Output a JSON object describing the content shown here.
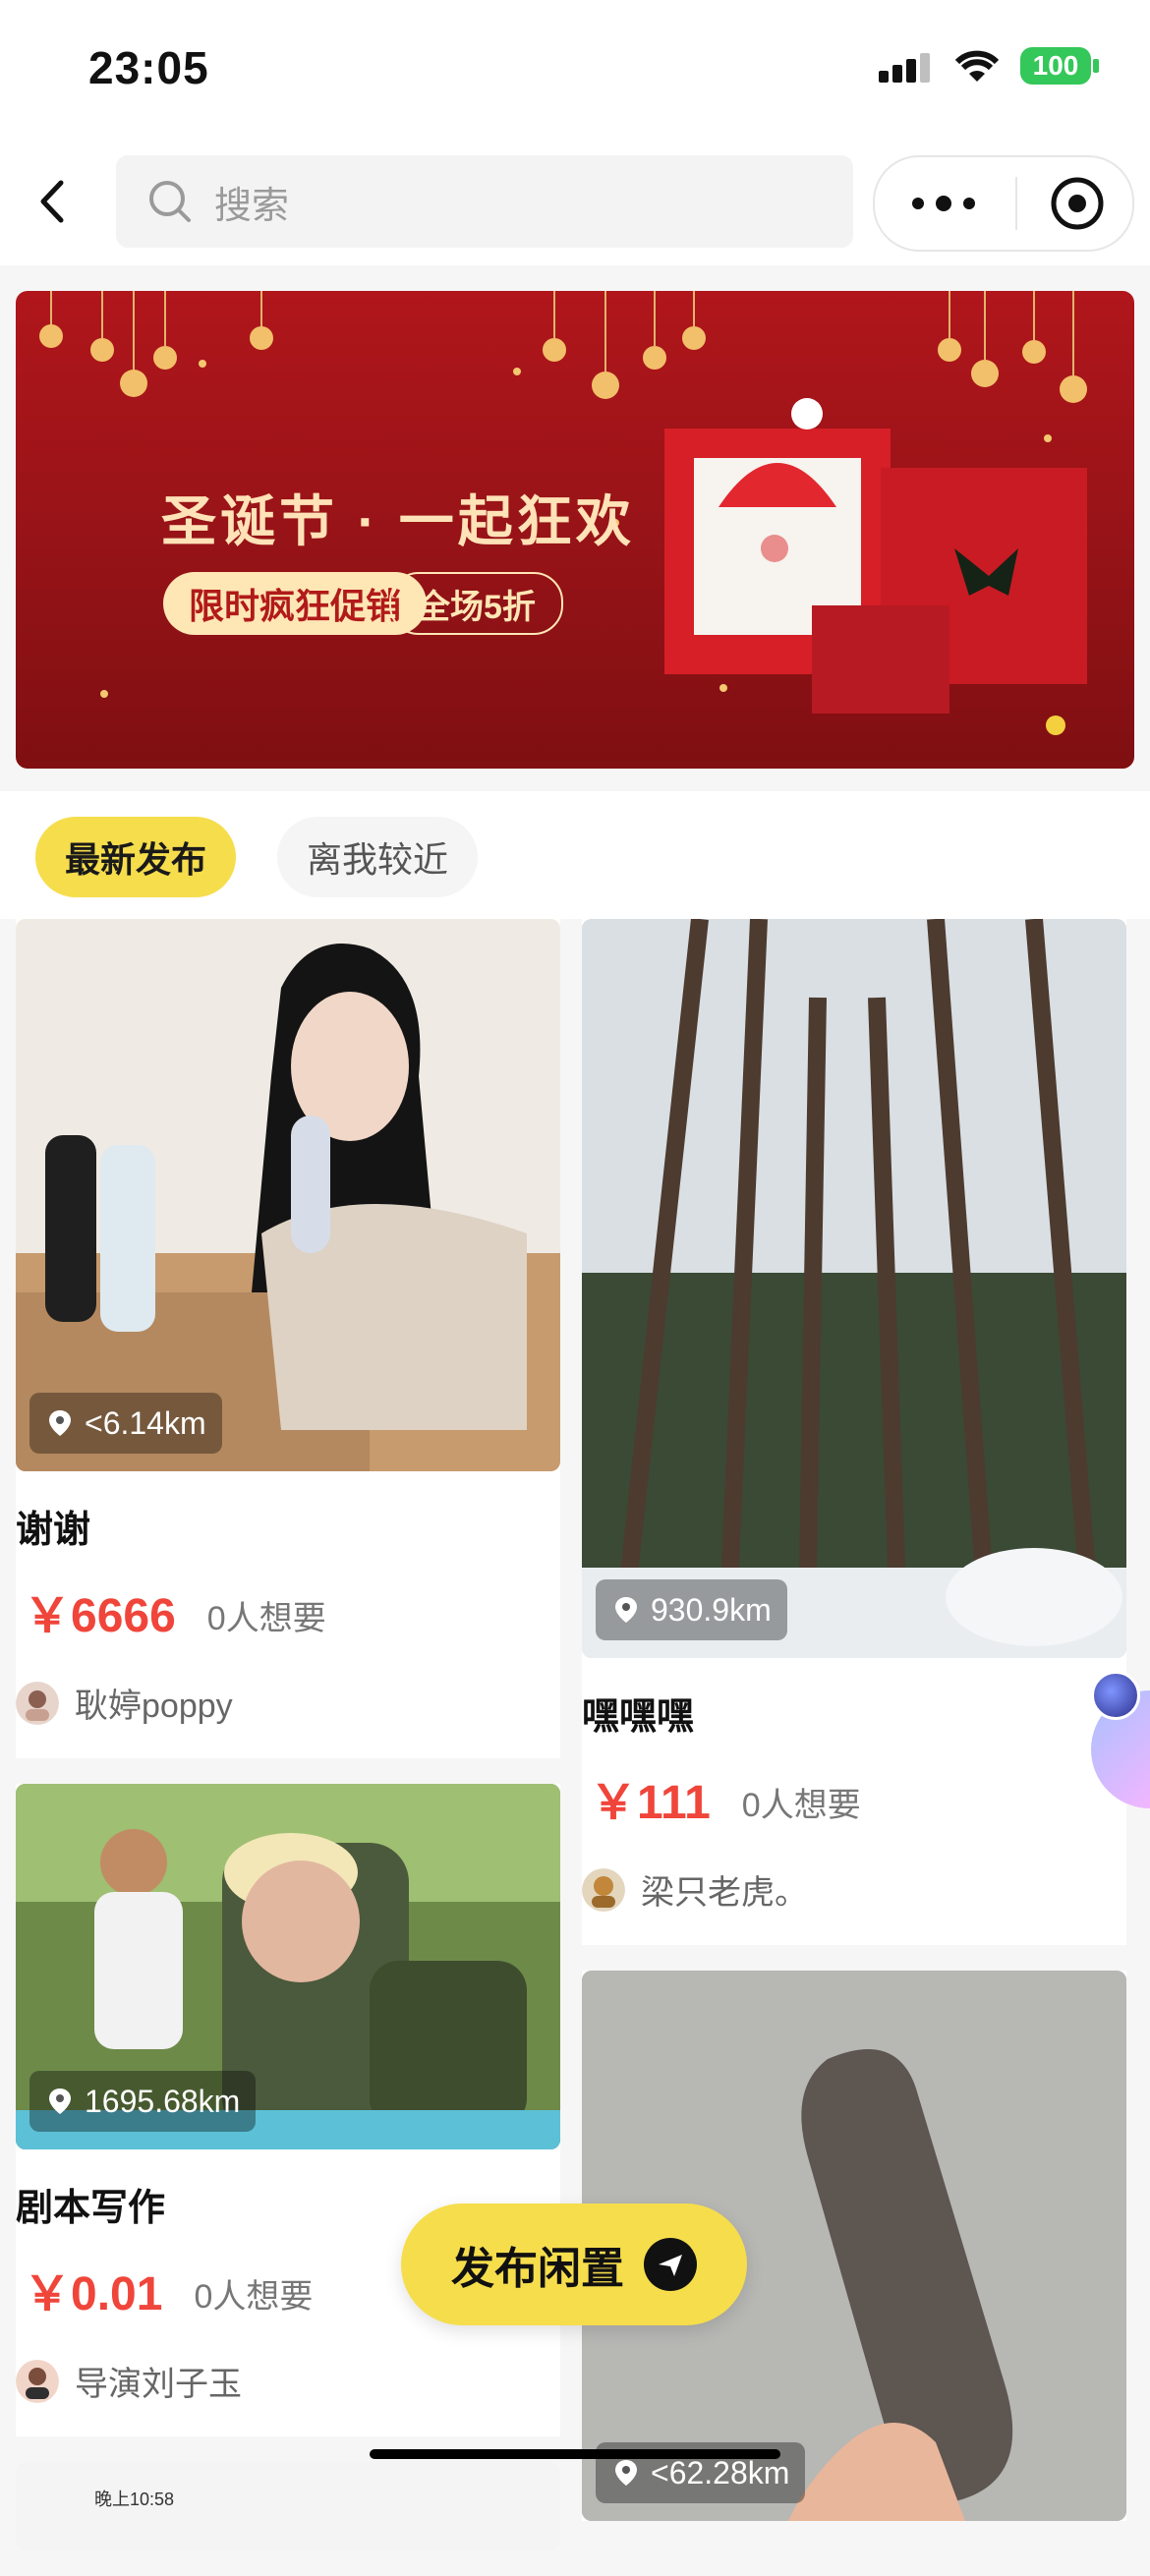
{
  "status_bar": {
    "time": "23:05",
    "battery": "100"
  },
  "nav": {
    "search_placeholder": "搜索"
  },
  "banner": {
    "title": "圣诞节 · 一起狂欢",
    "tag_primary": "限时疯狂促销",
    "tag_secondary": "全场5折",
    "colors": {
      "background": "#a4151a",
      "accent": "#ffe6b5"
    }
  },
  "filters": {
    "items": [
      {
        "label": "最新发布",
        "active": true
      },
      {
        "label": "离我较近",
        "active": false
      }
    ]
  },
  "listings": {
    "left": [
      {
        "title": "谢谢",
        "price": "￥6666",
        "wants": "0人想要",
        "seller": "耿婷poppy",
        "distance": "<6.14km"
      },
      {
        "title": "剧本写作",
        "price": "￥0.01",
        "wants": "0人想要",
        "seller": "导演刘子玉",
        "distance": "1695.68km"
      }
    ],
    "right": [
      {
        "title": "嘿嘿嘿",
        "price": "￥111",
        "wants": "0人想要",
        "seller": "梁只老虎。",
        "distance": "930.9km"
      },
      {
        "title": "",
        "price": "",
        "wants": "",
        "seller": "",
        "distance": "<62.28km"
      }
    ]
  },
  "third_card_preview": {
    "time_text": "晚上10:58"
  },
  "float_button": {
    "label": "发布闲置"
  },
  "colors": {
    "price": "#f0453a",
    "accent_yellow": "#f6dd4c"
  }
}
